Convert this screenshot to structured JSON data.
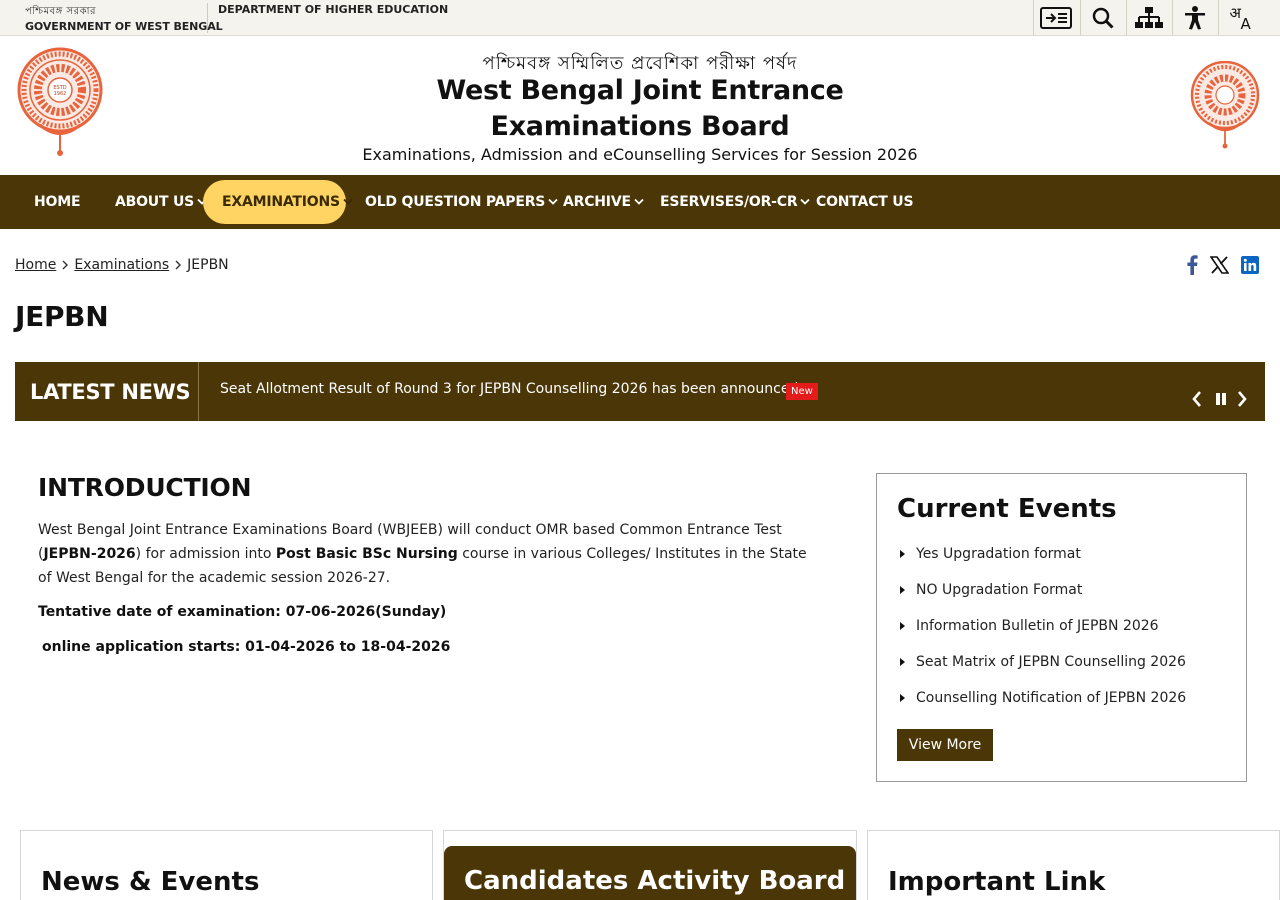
{
  "topbar": {
    "gov_bengali": "পশ্চিমবঙ্গ সরকার",
    "gov_english": "GOVERNMENT OF WEST BENGAL",
    "department": "DEPARTMENT OF HIGHER EDUCATION",
    "tools": [
      "skip-to-content-icon",
      "search-icon",
      "sitemap-icon",
      "accessibility-icon",
      "language-icon"
    ],
    "language_glyph": "अ",
    "language_glyph_2": "A"
  },
  "header": {
    "bengali_title": "পশ্চিমবঙ্গ সম্মিলিত প্রবেশিকা পরীক্ষা পর্ষদ",
    "title": "West Bengal Joint Entrance Examinations Board",
    "subtitle": "Examinations, Admission and eCounselling Services for Session 2026",
    "logo_text": "ESTD 1962"
  },
  "nav": {
    "items": [
      {
        "label": "HOME",
        "dropdown": false,
        "active": false
      },
      {
        "label": "ABOUT US",
        "dropdown": true,
        "active": false
      },
      {
        "label": "EXAMINATIONS",
        "dropdown": true,
        "active": true
      },
      {
        "label": "OLD QUESTION PAPERS",
        "dropdown": true,
        "active": false
      },
      {
        "label": "ARCHIVE",
        "dropdown": true,
        "active": false
      },
      {
        "label": "ESERVISES/OR-CR",
        "dropdown": true,
        "active": false
      },
      {
        "label": "CONTACT US",
        "dropdown": false,
        "active": false
      }
    ]
  },
  "breadcrumb": {
    "home": "Home",
    "section": "Examinations",
    "current": "JEPBN"
  },
  "share": [
    "facebook-icon",
    "x-twitter-icon",
    "linkedin-icon"
  ],
  "page_title": "JEPBN",
  "latest_news": {
    "label": "LATEST NEWS",
    "text": "Seat Allotment Result of Round 3 for JEPBN Counselling 2026 has been announced.",
    "badge": "New"
  },
  "intro": {
    "heading": "INTRODUCTION",
    "p_a": "West Bengal Joint Entrance Examinations Board (WBJEEB) will conduct OMR based Common Entrance Test (",
    "p_b": "JEPBN-2026",
    "p_c": ") for admission into ",
    "p_d": "Post Basic BSc Nursing",
    "p_e": " course in various Colleges/ Institutes in the State of West Bengal for the academic session 2026-27.",
    "tentative": "Tentative date of examination: 07-06-2026(Sunday)",
    "online": "online application starts: 01-04-2026 to 18-04-2026"
  },
  "current_events": {
    "heading": "Current Events",
    "items": [
      "Yes Upgradation format",
      "NO Upgradation Format",
      "Information Bulletin of JEPBN 2026",
      "Seat Matrix of JEPBN Counselling 2026",
      "Counselling Notification of JEPBN 2026"
    ],
    "view_more": "View More"
  },
  "cards": {
    "news": "News & Events",
    "candidates": "Candidates Activity Board",
    "links": "Important Link"
  },
  "colors": {
    "brand_brown": "#4a3607",
    "active_yellow": "#ffd463",
    "badge_red": "#e41b1b",
    "logo_orange": "#e8643c"
  }
}
